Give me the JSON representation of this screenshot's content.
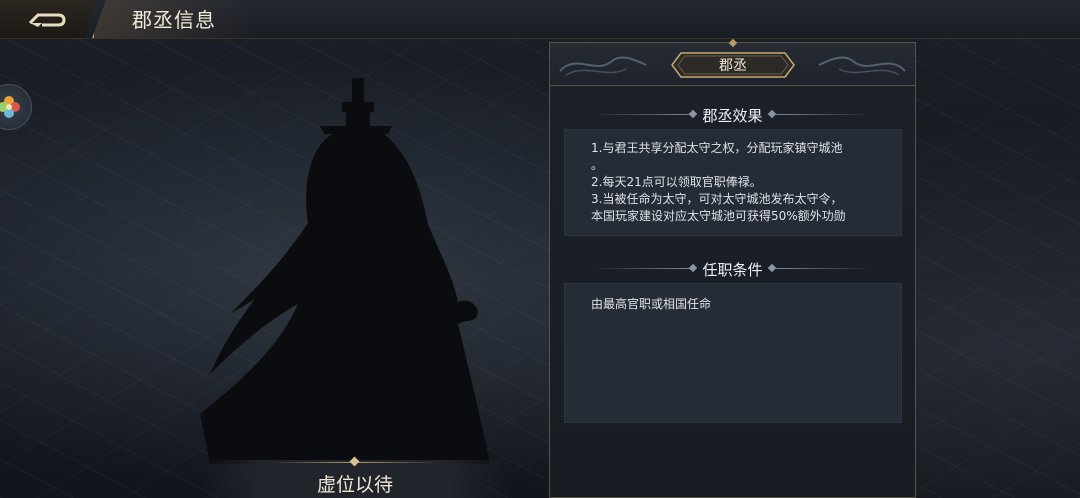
{
  "header": {
    "title": "郡丞信息",
    "back_icon": "back-arrow-icon"
  },
  "side": {
    "icon": "flower-icon"
  },
  "character": {
    "placeholder_name": "虚位以待"
  },
  "panel": {
    "rank": "郡丞",
    "effects": {
      "title": "郡丞效果",
      "lines": [
        "1.与君王共享分配太守之权，分配玩家镇守城池",
        "。",
        "2.每天21点可以领取官职俸禄。",
        "3.当被任命为太守，可对太守城池发布太守令，",
        "本国玩家建设对应太守城池可获得50%额外功勋"
      ]
    },
    "conditions": {
      "title": "任职条件",
      "text": "由最高官职或相国任命"
    }
  },
  "colors": {
    "gold": "#b59a6a",
    "panel_bg": "#1c2129",
    "box_bg": "#262c36"
  }
}
